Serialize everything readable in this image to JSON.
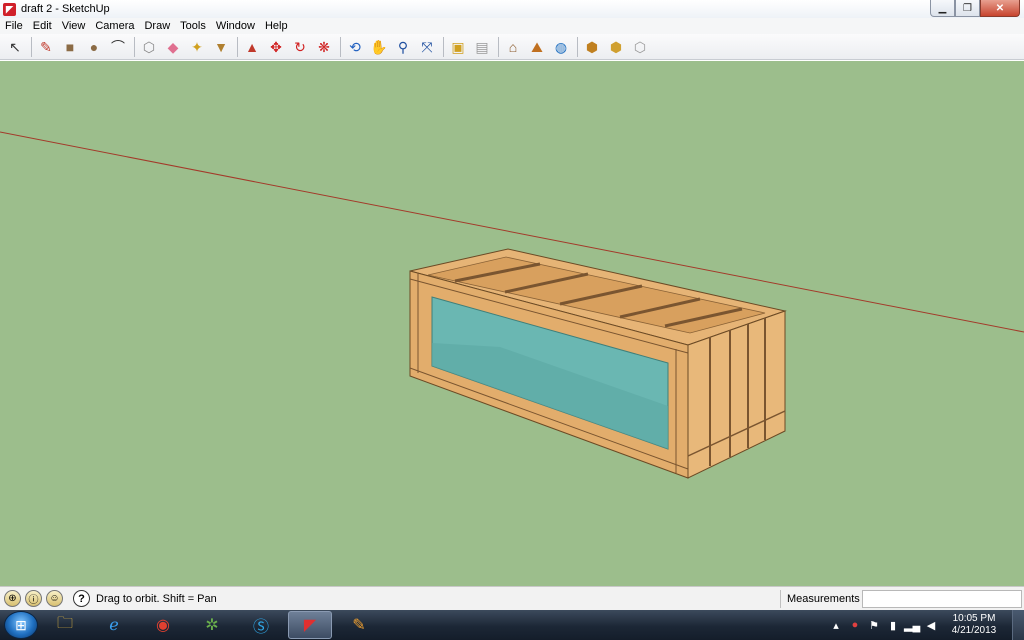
{
  "window": {
    "title": "draft 2 - SketchUp"
  },
  "menu": [
    "File",
    "Edit",
    "View",
    "Camera",
    "Draw",
    "Tools",
    "Window",
    "Help"
  ],
  "toolbar": {
    "groups": [
      [
        {
          "name": "select-tool-icon",
          "glyph": "↖",
          "color": "#333"
        }
      ],
      [
        {
          "name": "pencil-tool-icon",
          "glyph": "✎",
          "color": "#c0392b"
        },
        {
          "name": "rectangle-tool-icon",
          "glyph": "■",
          "color": "#8b6b45"
        },
        {
          "name": "circle-tool-icon",
          "glyph": "●",
          "color": "#8b6b45"
        },
        {
          "name": "arc-tool-icon",
          "glyph": "⌒",
          "color": "#333"
        }
      ],
      [
        {
          "name": "make-component-icon",
          "glyph": "⬡",
          "color": "#888"
        },
        {
          "name": "eraser-tool-icon",
          "glyph": "◆",
          "color": "#e07090"
        },
        {
          "name": "tape-measure-icon",
          "glyph": "✦",
          "color": "#d0a020"
        },
        {
          "name": "paint-bucket-icon",
          "glyph": "▼",
          "color": "#b08030"
        }
      ],
      [
        {
          "name": "push-pull-icon",
          "glyph": "▲",
          "color": "#c0392b"
        },
        {
          "name": "move-tool-icon",
          "glyph": "✥",
          "color": "#d02020"
        },
        {
          "name": "rotate-tool-icon",
          "glyph": "↻",
          "color": "#d02020"
        },
        {
          "name": "offset-tool-icon",
          "glyph": "❋",
          "color": "#d02020"
        }
      ],
      [
        {
          "name": "orbit-tool-icon",
          "glyph": "⟲",
          "color": "#2060c0"
        },
        {
          "name": "pan-tool-icon",
          "glyph": "✋",
          "color": "#666"
        },
        {
          "name": "zoom-tool-icon",
          "glyph": "⚲",
          "color": "#2050a0"
        },
        {
          "name": "zoom-extents-icon",
          "glyph": "⤧",
          "color": "#2050a0"
        }
      ],
      [
        {
          "name": "previous-view-icon",
          "glyph": "▣",
          "color": "#d0a020"
        },
        {
          "name": "next-view-icon",
          "glyph": "▤",
          "color": "#999"
        }
      ],
      [
        {
          "name": "add-location-icon",
          "glyph": "⌂",
          "color": "#8b5a2b"
        },
        {
          "name": "toggle-terrain-icon",
          "glyph": "⛰",
          "color": "#c07020"
        },
        {
          "name": "google-earth-icon",
          "glyph": "◍",
          "color": "#2070c0"
        }
      ],
      [
        {
          "name": "get-models-icon",
          "glyph": "⬢",
          "color": "#c08020"
        },
        {
          "name": "share-model-icon",
          "glyph": "⬢",
          "color": "#d0a030"
        },
        {
          "name": "share-component-icon",
          "glyph": "⬡",
          "color": "#999"
        }
      ]
    ]
  },
  "status": {
    "text": "Drag to orbit.  Shift = Pan",
    "measurements_label": "Measurements",
    "measurements_value": ""
  },
  "taskbar": {
    "apps": [
      {
        "name": "file-explorer-icon",
        "glyph": "🗀",
        "color": "#f0c040",
        "active": false
      },
      {
        "name": "internet-explorer-icon",
        "glyph": "ℯ",
        "color": "#3aa0f0",
        "active": false
      },
      {
        "name": "chrome-icon",
        "glyph": "◉",
        "color": "#e04030",
        "active": false
      },
      {
        "name": "media-app-icon",
        "glyph": "✲",
        "color": "#6ab04c",
        "active": false
      },
      {
        "name": "skype-icon",
        "glyph": "Ⓢ",
        "color": "#30a8e8",
        "active": false
      },
      {
        "name": "sketchup-taskbar-icon",
        "glyph": "◤",
        "color": "#e03030",
        "active": true
      },
      {
        "name": "paint-app-icon",
        "glyph": "✎",
        "color": "#f0a030",
        "active": false
      }
    ],
    "time": "10:05 PM",
    "date": "4/21/2013"
  },
  "colors": {
    "viewport_bg": "#9cbe8c",
    "wood": "#e6b476",
    "wood_dark": "#b98a52",
    "glass": "#6ab7b2",
    "axis_red": "#a33a2a"
  }
}
